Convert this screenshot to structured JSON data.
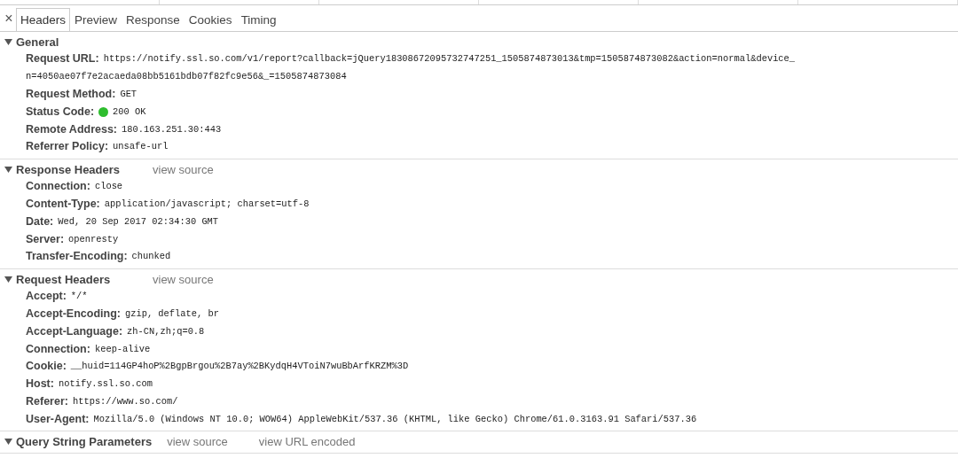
{
  "close": "×",
  "tabs": [
    {
      "label": "Headers",
      "selected": true
    },
    {
      "label": "Preview",
      "selected": false
    },
    {
      "label": "Response",
      "selected": false
    },
    {
      "label": "Cookies",
      "selected": false
    },
    {
      "label": "Timing",
      "selected": false
    }
  ],
  "sections": [
    {
      "title": "General",
      "expanded": true,
      "items": [
        {
          "name": "Request URL:",
          "value_lines": [
            "https://notify.ssl.so.com/v1/report?callback=jQuery18308672095732747251_1505874873013&tmp=1505874873082&action=normal&device_",
            "n=4050ae07f7e2acaeda08bb5161bdb07f82fc9e56&_=1505874873084"
          ]
        },
        {
          "name": "Request Method:",
          "value_lines": [
            "GET"
          ]
        },
        {
          "name": "Status Code:",
          "value_lines": [
            "200 OK"
          ],
          "color": "#2ebd2e"
        },
        {
          "name": "Remote Address:",
          "value_lines": [
            "180.163.251.30:443"
          ]
        },
        {
          "name": "Referrer Policy:",
          "value_lines": [
            "unsafe-url"
          ]
        }
      ]
    },
    {
      "title": "Response Headers",
      "expanded": true,
      "links": [
        "view source"
      ],
      "items": [
        {
          "name": "Connection:",
          "value_lines": [
            "close"
          ]
        },
        {
          "name": "Content-Type:",
          "value_lines": [
            "application/javascript; charset=utf-8"
          ]
        },
        {
          "name": "Date:",
          "value_lines": [
            "Wed, 20 Sep 2017 02:34:30 GMT"
          ]
        },
        {
          "name": "Server:",
          "value_lines": [
            "openresty"
          ]
        },
        {
          "name": "Transfer-Encoding:",
          "value_lines": [
            "chunked"
          ]
        }
      ]
    },
    {
      "title": "Request Headers",
      "expanded": true,
      "links": [
        "view source"
      ],
      "items": [
        {
          "name": "Accept:",
          "value_lines": [
            "*/*"
          ]
        },
        {
          "name": "Accept-Encoding:",
          "value_lines": [
            "gzip, deflate, br"
          ]
        },
        {
          "name": "Accept-Language:",
          "value_lines": [
            "zh-CN,zh;q=0.8"
          ]
        },
        {
          "name": "Connection:",
          "value_lines": [
            "keep-alive"
          ]
        },
        {
          "name": "Cookie:",
          "value_lines": [
            "__huid=114GP4hoP%2BgpBrgou%2B7ay%2BKydqH4VToiN7wuBbArfKRZM%3D"
          ]
        },
        {
          "name": "Host:",
          "value_lines": [
            "notify.ssl.so.com"
          ]
        },
        {
          "name": "Referer:",
          "value_lines": [
            "https://www.so.com/"
          ]
        },
        {
          "name": "User-Agent:",
          "value_lines": [
            "Mozilla/5.0 (Windows NT 10.0; WOW64) AppleWebKit/537.36 (KHTML, like Gecko) Chrome/61.0.3163.91 Safari/537.36"
          ]
        }
      ]
    },
    {
      "title": "Query String Parameters",
      "expanded": true,
      "links": [
        "view source",
        "view URL encoded"
      ]
    }
  ]
}
